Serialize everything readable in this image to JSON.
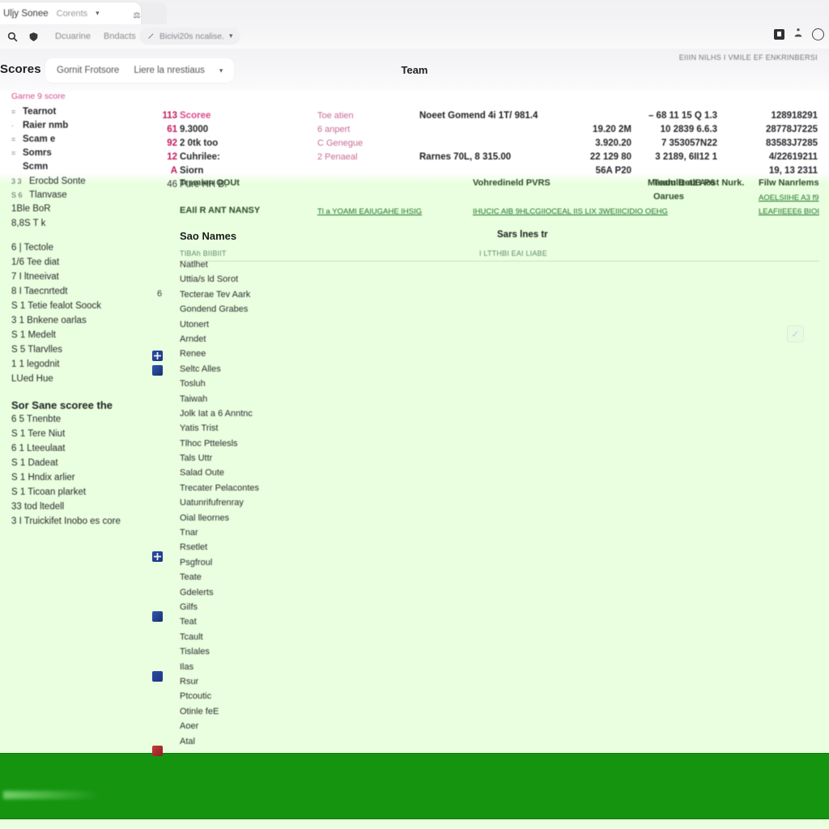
{
  "browser": {
    "tab_active_title": "Uljy Sonee",
    "tab_active_sub": "Corents",
    "tab_chevron": "chevron-down",
    "tab_icon": "page-icon",
    "toolbar": {
      "search_icon": "search-icon",
      "shield_icon": "shield-icon",
      "link1": "Dcuarine",
      "link2": "Bndacts",
      "omnibox_icon": "pencil-icon",
      "omnibox_text": "Bicivi20s ncalise.",
      "omnibox_chevron": "chevron-down"
    },
    "right_icons": {
      "extension_badge": "extension-icon",
      "share_icon": "share-icon",
      "profile_icon": "profile-circle-icon"
    }
  },
  "app_header": {
    "title": "Scores",
    "filter": {
      "primary": "Gornit Frotsore",
      "secondary": "Liere la nrestiaus",
      "chevron": "chevron-down"
    },
    "center_title": "Team",
    "meta": "EIIIN NILHS  I VMILE EF ENKRINBERSI"
  },
  "summary": {
    "heading": "Garne 9 score",
    "rows": [
      {
        "bullet": "=",
        "label": "Tearnot",
        "num": "113",
        "col2": "Scoree",
        "col3": "Toe atien",
        "col4": "Noeet Gomend 4i 1T/ 981.4",
        "na": "– 68 11 15 Q 1.3",
        "nc": "128918291"
      },
      {
        "bullet": "·",
        "label": "Raier nmb",
        "num": "61",
        "col2": "9.3000",
        "col3": "6 anpert",
        "col4": "",
        "na": "19.20 2M",
        "nb": "10 2839 6.6.3",
        "nc": "28778J7225"
      },
      {
        "bullet": "=",
        "label": "Scam e",
        "num": "92",
        "col2": "2 0tk too",
        "col3": "C Genegue",
        "col4": "",
        "na": "3.920.20",
        "nb": "7 353057N22",
        "nc": "83583J7285"
      },
      {
        "bullet": "=",
        "label": "Somrs",
        "num": "12",
        "col2": "Cuhrilee:",
        "col3": "2 Penaeal",
        "col4": "Rarnes 70L, 8 315.00",
        "na": "22 129 80",
        "nb": "3 2189, 6II12 1",
        "nc": "4/22619211"
      },
      {
        "bullet": "",
        "label": "Scmn",
        "num": "A",
        "col2": "Siorn",
        "col3": "",
        "col4": "",
        "na": "56A P20",
        "nc": "19, 13 2311"
      }
    ]
  },
  "band": {
    "rows": [
      {
        "bullet": "3 3",
        "label": "Erocbd Sonte",
        "num": "46",
        "col2": "Pure HH B:",
        "cells": [
          "Trsmien OOUt",
          "Vohredineld PVRS",
          "Meaduliz alB P6",
          "Team Betz Aost Nurk.",
          "Filw Nanrlems"
        ]
      },
      {
        "bullet": "S 6",
        "label": "Tlanvase",
        "col2": "",
        "cells": [
          "",
          "",
          "",
          "Oarues",
          "AOELSIIHE  A3 f9"
        ]
      }
    ],
    "links": [
      "EAIl R ANT NANSY",
      "Tl a YOAMI EAIUGAHE IHSIG",
      "IHUCIC AIB 9HLCGIIOCEAL IIS LIX 3WEIIICIDIO OEHG",
      "LEAFIIEEE6 BIOI"
    ]
  },
  "left_list": {
    "rows_top": [
      "1Ble BoR",
      "8,8S T k",
      "6 | Tectole",
      "1/6 Tee diat",
      "7 I ltneeivat",
      "8 I Taecnrtedt",
      "S 1 Tetie fealot Soock",
      "3 1 Bnkene oarlas",
      "S 1 Medelt",
      "S 5 Tlarvlles",
      "1 1 legodnit",
      "LUed Hue"
    ],
    "section_heading": "Sor Sane scoree the",
    "rows_bottom": [
      "6 5 Tnenbte",
      "S 1 Tere Niut",
      "6 1 Lteeulaat",
      "S 1 Dadeat",
      "S 1 Hndix arlier",
      "S 1 Ticoan plarket",
      "33  tod ltedell",
      "3 I Truickifet Inobo es core"
    ]
  },
  "list_panel": {
    "heading": "Sao Names",
    "subheading": "TIBAh BIIBIIT",
    "heading2": "Sars lnes tr",
    "subheading2": "I LTTHBI EAI LIABE",
    "checkbox": "check-icon",
    "items": [
      {
        "text": "Natlhet"
      },
      {
        "text": "Uttia/s ld Sorot",
        "num": "6"
      },
      {
        "text": "Tecterae Tev Aark"
      },
      {
        "text": "Gondend Grabes"
      },
      {
        "text": "Utonert"
      },
      {
        "text": "Arndet"
      },
      {
        "text": "Renee",
        "icon": "blue"
      },
      {
        "text": "Seltc Alles",
        "icon": "blue2"
      },
      {
        "text": "Tosluh"
      },
      {
        "text": "Taiwah"
      },
      {
        "text": "Jolk Iat a 6 Anntnc"
      },
      {
        "text": "Yatis Trist"
      },
      {
        "text": "Tlhoc Pttelesls"
      },
      {
        "text": "Tals Uttr"
      },
      {
        "text": "Salad Oute",
        "icon": "blue"
      },
      {
        "text": "Trecater Pelacontes"
      },
      {
        "text": "Uatunrifufrenray"
      },
      {
        "text": "Oial lleornes"
      },
      {
        "text": "Tnar",
        "icon": "blue2"
      },
      {
        "text": "Rsetlet"
      },
      {
        "text": "Psgfroul"
      },
      {
        "text": "Teate"
      },
      {
        "text": "Gdelerts",
        "icon": "blue"
      },
      {
        "text": "Gilfs"
      },
      {
        "text": "Teat"
      },
      {
        "text": "Tcault"
      },
      {
        "text": "Tislales"
      },
      {
        "text": "Ilas"
      },
      {
        "text": "Rsur",
        "icon": "red"
      },
      {
        "text": "Ptcoutic"
      },
      {
        "text": "Otinle feE"
      },
      {
        "text": "Aoer"
      },
      {
        "text": "Atal"
      }
    ]
  },
  "colors": {
    "green_wash": "#e9ffdf",
    "green_footer": "#159410",
    "accent_pink": "#d84a8e",
    "accent_magenta": "#c2185b"
  }
}
